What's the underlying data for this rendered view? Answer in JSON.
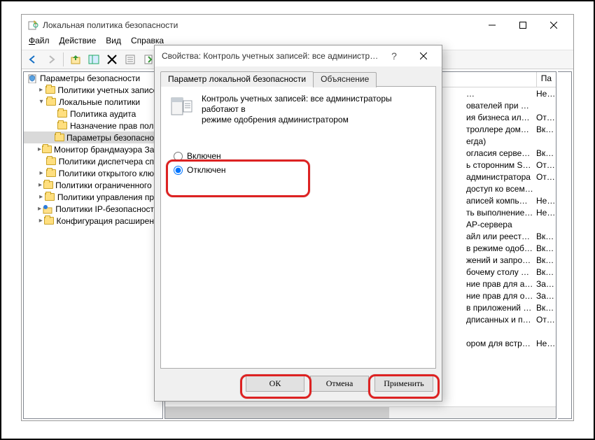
{
  "mmc": {
    "title": "Локальная политика безопасности",
    "menu": {
      "file": "Файл",
      "action": "Действие",
      "view": "Вид",
      "help": "Справка"
    },
    "tree": {
      "root": "Параметры безопасности",
      "items": [
        {
          "label": "Политики учетных записей",
          "depth": 1,
          "tw": ">"
        },
        {
          "label": "Локальные политики",
          "depth": 1,
          "tw": "v"
        },
        {
          "label": "Политика аудита",
          "depth": 2,
          "tw": ""
        },
        {
          "label": "Назначение прав пол…",
          "depth": 2,
          "tw": ""
        },
        {
          "label": "Параметры безопасно…",
          "depth": 2,
          "tw": "",
          "selected": true
        },
        {
          "label": "Монитор брандмауэра За…",
          "depth": 1,
          "tw": ">"
        },
        {
          "label": "Политики диспетчера сп…",
          "depth": 1,
          "tw": ""
        },
        {
          "label": "Политики открытого клю…",
          "depth": 1,
          "tw": ">"
        },
        {
          "label": "Политики ограниченного …",
          "depth": 1,
          "tw": ">"
        },
        {
          "label": "Политики управления пр…",
          "depth": 1,
          "tw": ">"
        },
        {
          "label": "Политики IP-безопасност…",
          "depth": 1,
          "tw": ">",
          "special": "ip"
        },
        {
          "label": "Конфигурация расширен…",
          "depth": 1,
          "tw": ">"
        }
      ]
    },
    "list": {
      "valueHeader": "Па",
      "rows": [
        {
          "n": "…",
          "v": "Не…"
        },
        {
          "n": "ователей при входе в си…",
          "v": ""
        },
        {
          "n": "ия бизнеса или смарт-ка…",
          "v": "От…"
        },
        {
          "n": "троллере домена для от…",
          "v": "Вк…"
        },
        {
          "n": "егда)",
          "v": ""
        },
        {
          "n": "огласия сервера)",
          "v": "Вк…"
        },
        {
          "n": "ь сторонним SMB-серв…",
          "v": "От…"
        },
        {
          "n": "администратора",
          "v": "От…"
        },
        {
          "n": "доступ ко всем дискам …",
          "v": ""
        },
        {
          "n": "аписей компьютера",
          "v": "Не…"
        },
        {
          "n": "ть выполнение заданий …",
          "v": "Не…"
        },
        {
          "n": "AP-сервера",
          "v": ""
        },
        {
          "n": "айл или реестр на осно…",
          "v": "Вк…"
        },
        {
          "n": "в режиме одобрения ад…",
          "v": "Вк…"
        },
        {
          "n": "жений и запрос на повы…",
          "v": "Вк…"
        },
        {
          "n": "бочему столу при вып…",
          "v": "Вк…"
        },
        {
          "n": "ние прав для администра…",
          "v": "За…"
        },
        {
          "n": "ние прав для обычных п…",
          "v": "За…"
        },
        {
          "n": "в приложений только при…",
          "v": "Вк…"
        },
        {
          "n": "дписанных и проверенн…",
          "v": "От…"
        },
        {
          "n": "",
          "v": ""
        },
        {
          "n": "ором для встроенной уч…",
          "v": "Не…"
        }
      ]
    }
  },
  "dialog": {
    "title": "Свойства: Контроль учетных записей: все администрат…",
    "tabs": {
      "local": "Параметр локальной безопасности",
      "explain": "Объяснение"
    },
    "policyLine1": "Контроль учетных записей: все администраторы работают в",
    "policyLine2": "режиме одобрения администратором",
    "radios": {
      "on": "Включен",
      "off": "Отключен"
    },
    "buttons": {
      "ok": "ОК",
      "cancel": "Отмена",
      "apply": "Применить"
    }
  }
}
